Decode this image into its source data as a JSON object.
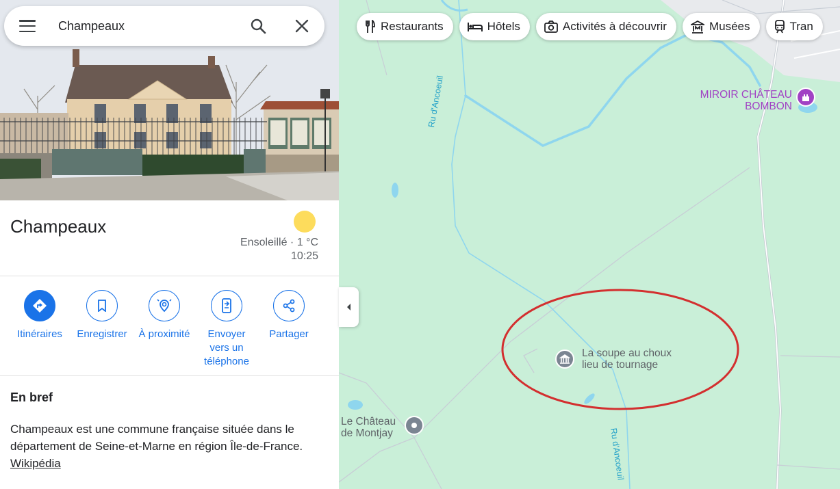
{
  "search": {
    "value": "Champeaux"
  },
  "place": {
    "title": "Champeaux",
    "weather": "Ensoleillé · 1 °C",
    "time": "10:25"
  },
  "actions": [
    {
      "label": "Itinéraires",
      "icon": "directions-icon"
    },
    {
      "label": "Enregistrer",
      "icon": "bookmark-icon"
    },
    {
      "label": "À proximité",
      "icon": "nearby-icon"
    },
    {
      "label": "Envoyer vers un téléphone",
      "icon": "send-to-phone-icon"
    },
    {
      "label": "Partager",
      "icon": "share-icon"
    }
  ],
  "overview": {
    "title": "En bref",
    "text": "Champeaux est une commune française située dans le département de Seine-et-Marne en région Île-de-France. ",
    "link": "Wikipédia"
  },
  "chips": [
    {
      "label": "Restaurants",
      "icon": "restaurant-icon"
    },
    {
      "label": "Hôtels",
      "icon": "hotel-icon"
    },
    {
      "label": "Activités à découvrir",
      "icon": "camera-icon"
    },
    {
      "label": "Musées",
      "icon": "museum-icon"
    },
    {
      "label": "Tran",
      "icon": "transit-icon"
    }
  ],
  "map": {
    "poi_miroir_line1": "MIROIR CHÂTEAU",
    "poi_miroir_line2": "BOMBON",
    "poi_soupe_line1": "La soupe au choux",
    "poi_soupe_line2": "lieu de tournage",
    "poi_montjay_line1": "Le Château",
    "poi_montjay_line2": "de Montjay",
    "road_1": "Ru d'Ancoeuil",
    "road_2": "Ru d'Ancoeuil",
    "colors": {
      "map_bg": "#c9efd8",
      "water": "#8fd6ee",
      "annotation": "#d32f2f",
      "accent": "#1a73e8",
      "poi_purple": "#a142c4"
    }
  }
}
